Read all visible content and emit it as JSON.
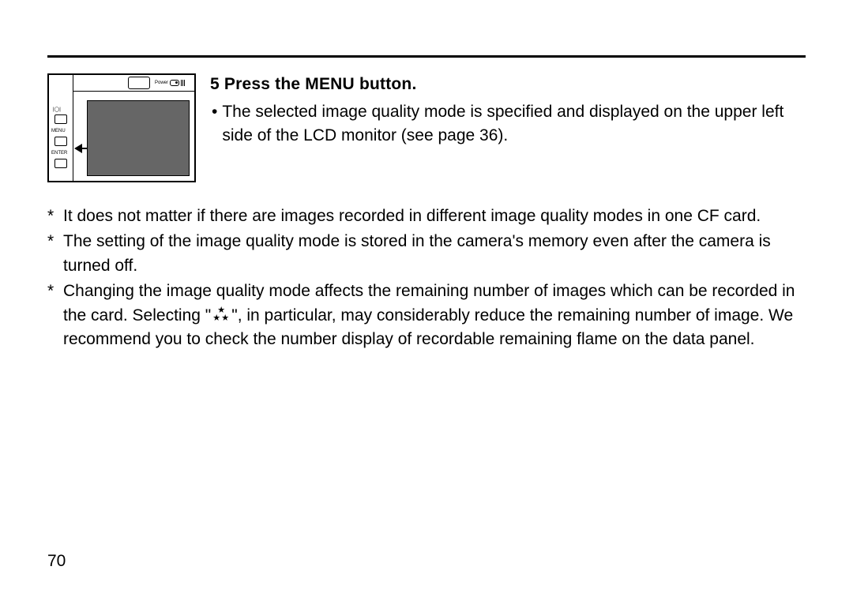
{
  "step": {
    "number": "5",
    "title": "Press the MENU button.",
    "bullet": "The selected image quality mode is specified and displayed on the upper left side of the LCD monitor (see page 36)."
  },
  "illustration": {
    "power_label": "Power",
    "menu_label": "MENU",
    "enter_label": "ENTER",
    "disp_label": "|◯|"
  },
  "notes": [
    "It does not matter if there are images recorded in different image quality modes in one CF card.",
    "The setting of the image quality mode is stored in the camera's memory even after the camera is turned off.",
    "Changing the image quality mode affects the remaining number of images which can be recorded in the card. Selecting \" ★★★ \", in particular, may considerably reduce the remaining number of image. We recommend you to check the number display of recordable remaining flame on the data panel."
  ],
  "page_number": "70"
}
